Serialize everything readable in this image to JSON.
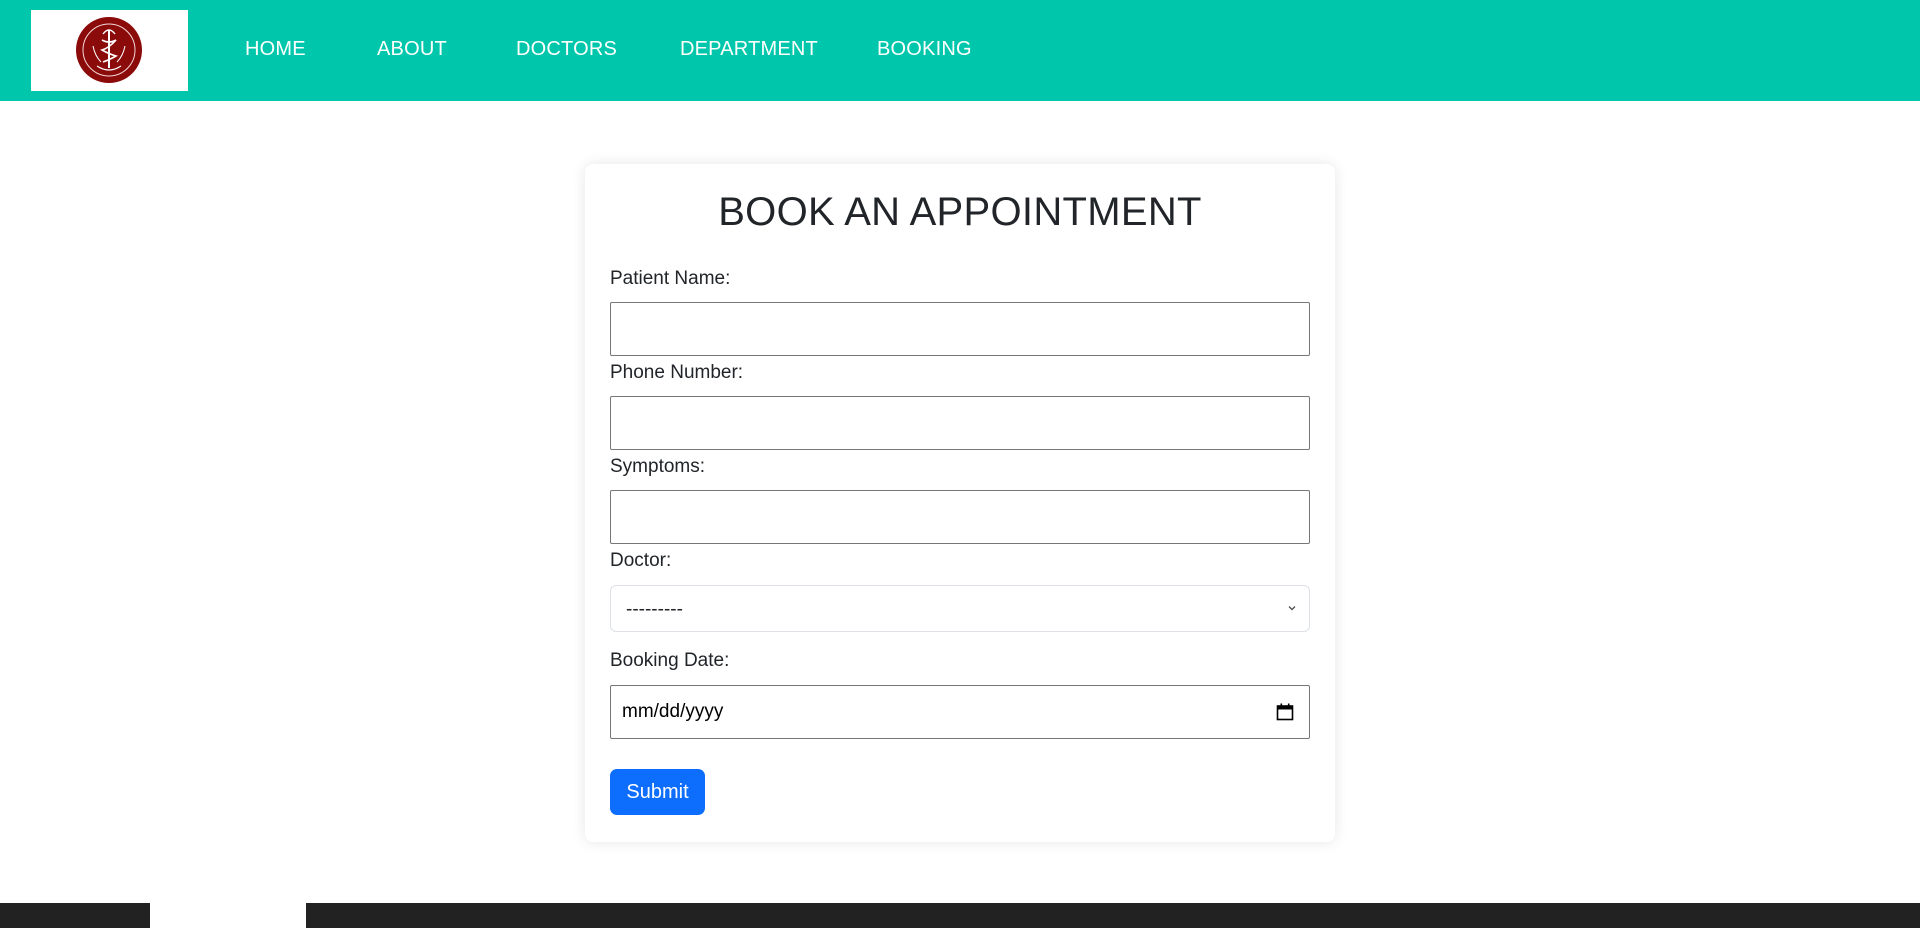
{
  "nav": {
    "items": [
      {
        "label": "HOME"
      },
      {
        "label": "ABOUT"
      },
      {
        "label": "DOCTORS"
      },
      {
        "label": "DEPARTMENT"
      },
      {
        "label": "BOOKING"
      }
    ]
  },
  "form": {
    "title": "BOOK AN APPOINTMENT",
    "patient_name_label": "Patient Name:",
    "patient_name_value": "",
    "phone_label": "Phone Number:",
    "phone_value": "",
    "symptoms_label": "Symptoms:",
    "symptoms_value": "",
    "doctor_label": "Doctor:",
    "doctor_selected": "---------",
    "booking_date_label": "Booking Date:",
    "booking_date_placeholder": "mm/dd/yyyy",
    "submit_label": "Submit"
  },
  "icons": {
    "logo": "hospital-emblem-icon",
    "select": "chevron-down-icon",
    "date": "calendar-icon"
  },
  "colors": {
    "navbar": "#00c7ab",
    "primary_button": "#0d6efd",
    "footer": "#222222",
    "logo_emblem": "#8b0a0a"
  }
}
